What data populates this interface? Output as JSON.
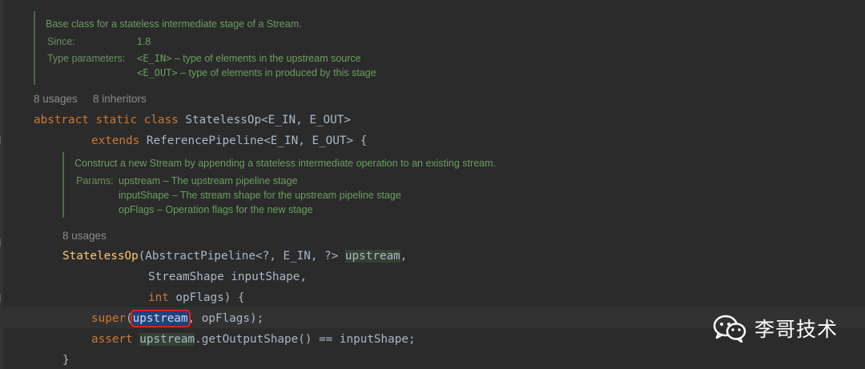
{
  "class_doc": {
    "description": "Base class for a stateless intermediate stage of a Stream.",
    "since_label": "Since:",
    "since_value": "1.8",
    "type_params_label": "Type parameters:",
    "type_params": [
      {
        "name": "<E_IN>",
        "desc": " – type of elements in the upstream source"
      },
      {
        "name": "<E_OUT>",
        "desc": " – type of elements in produced by this stage"
      }
    ]
  },
  "class_hints": {
    "usages": "8 usages",
    "inheritors": "8 inheritors"
  },
  "class_decl": {
    "line1": {
      "kw": "abstract static class",
      "name": " StatelessOp",
      "generics": "<E_IN, E_OUT>"
    },
    "line2": {
      "kw": "extends",
      "name": " ReferencePipeline",
      "generics": "<E_IN, E_OUT> {"
    }
  },
  "ctor_doc": {
    "description": "Construct a new Stream by appending a stateless intermediate operation to an existing stream.",
    "params_label": "Params:",
    "params": [
      {
        "name": "upstream",
        "desc": " – The upstream pipeline stage"
      },
      {
        "name": "inputShape",
        "desc": " – The stream shape for the upstream pipeline stage"
      },
      {
        "name": "opFlags",
        "desc": " – Operation flags for the new stage"
      }
    ]
  },
  "ctor_hints": {
    "usages": "8 usages"
  },
  "ctor": {
    "name": "StatelessOp",
    "sig1_type": "(AbstractPipeline<?, E_IN, ?> ",
    "sig1_param": "upstream",
    "sig1_end": ",",
    "sig2": "StreamShape inputShape,",
    "sig3_kw": "int",
    "sig3_rest": " opFlags) {",
    "super_kw": "super",
    "super_open": "(",
    "super_arg_selected": "upstream",
    "super_rest": ", opFlags);",
    "assert_kw": "assert",
    "assert_param": "upstream",
    "assert_rest": ".getOutputShape() == inputShape;",
    "close": "}"
  },
  "watermark": {
    "text": "李哥技术",
    "icon": "wechat-icon"
  }
}
